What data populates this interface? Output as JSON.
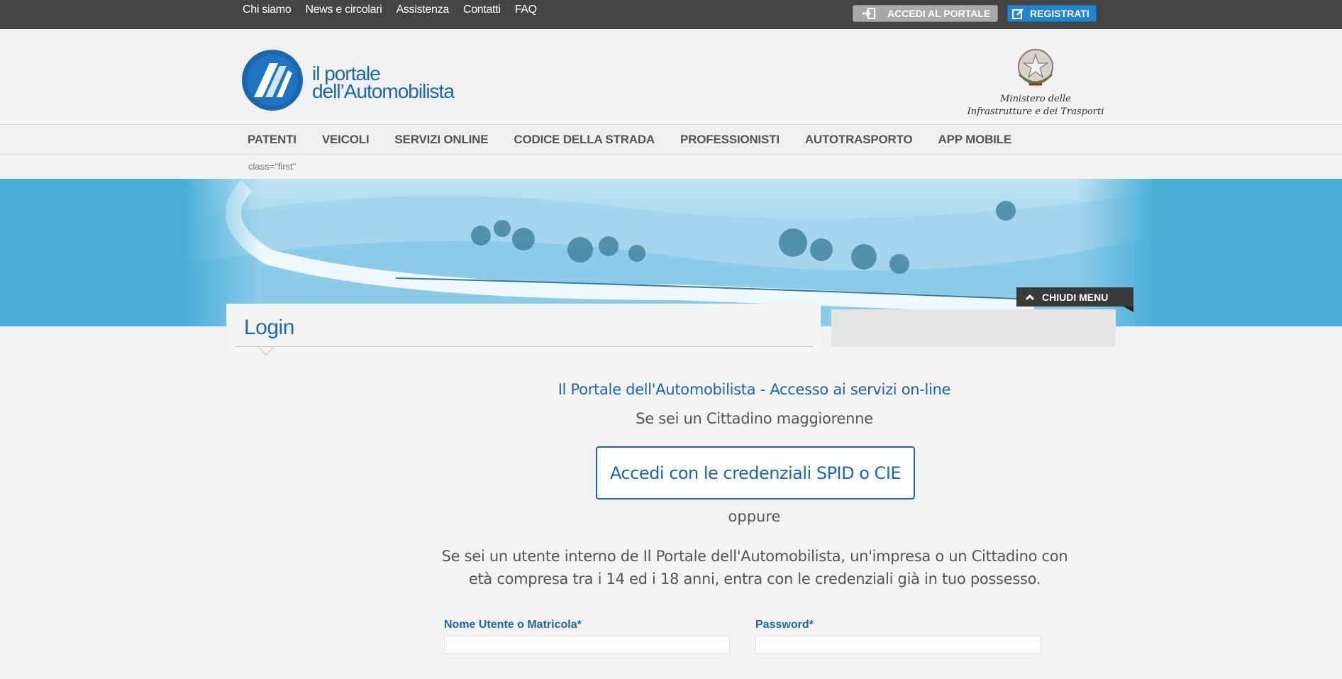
{
  "topbar": {
    "links": [
      "Chi siamo",
      "News e circolari",
      "Assistenza",
      "Contatti",
      "FAQ"
    ],
    "accedi_label": "ACCEDI AL PORTALE",
    "registrati_label": "REGISTRATI"
  },
  "header": {
    "logo_line1": "il portale",
    "logo_line2": "dell’Automobilista",
    "ministero_line1": "Ministero delle",
    "ministero_line2": "Infrastrutture e dei Trasporti"
  },
  "nav": {
    "items": [
      "PATENTI",
      "VEICOLI",
      "SERVIZI ONLINE",
      "CODICE DELLA STRADA",
      "PROFESSIONISTI",
      "AUTOTRASPORTO",
      "APP MOBILE"
    ]
  },
  "breadcrumb": "class=\"first\"",
  "banner": {
    "chiudi_label": "CHIUDI MENU"
  },
  "login": {
    "title": "Login",
    "portal_title": "Il Portale dell'Automobilista - Accesso ai servizi on-line",
    "cittadino_text": "Se sei un Cittadino maggiorenne",
    "spid_button": "Accedi con le credenziali SPID o CIE",
    "oppure": "oppure",
    "description": "Se sei un utente interno de Il Portale dell'Automobilista, un'impresa o un Cittadino con età compresa tra i 14 ed i 18 anni, entra con le credenziali già in tuo possesso.",
    "username_label": "Nome Utente o Matricola*",
    "username_value": "",
    "password_label": "Password*",
    "password_value": ""
  },
  "colors": {
    "primary_blue": "#1a67ad",
    "topbar_bg": "#444444",
    "banner_blue": "#4aaed8",
    "register_blue": "#1f86cf"
  }
}
